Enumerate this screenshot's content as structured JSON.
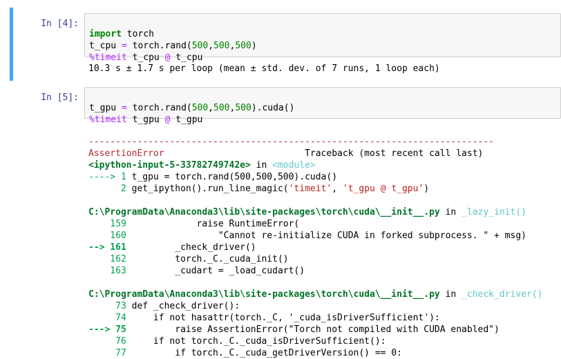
{
  "cell1": {
    "prompt": "In [4]:",
    "code": {
      "l1": {
        "kw": "import",
        "rest": " torch"
      },
      "l2": {
        "a": "t_cpu ",
        "eq": "=",
        "b": " torch.rand(",
        "n1": "500",
        "c1": ",",
        "n2": "500",
        "c2": ",",
        "n3": "500",
        "d": ")"
      },
      "l3": {
        "magic": "%timeit",
        "a": " t_cpu ",
        "at": "@",
        "b": " t_cpu"
      }
    },
    "output": "10.3 s ± 1.7 s per loop (mean ± std. dev. of 7 runs, 1 loop each)"
  },
  "cell2": {
    "prompt": "In [5]:",
    "code": {
      "l1": {
        "a": "t_gpu ",
        "eq": "=",
        "b": " torch.rand(",
        "n1": "500",
        "c1": ",",
        "n2": "500",
        "c2": ",",
        "n3": "500",
        "d": ").cuda()"
      },
      "l2": {
        "magic": "%timeit",
        "a": " t_gpu ",
        "at": "@",
        "b": " t_gpu"
      }
    },
    "traceback": {
      "dashes": "---------------------------------------------------------------------------",
      "error_name": "AssertionError",
      "header_right": "Traceback (most recent call last)",
      "frame0_file": "<ipython-input-5-33782749742e>",
      "frame0_in": " in ",
      "frame0_mod": "<module>",
      "f0_arrow": "----> 1",
      "f0_line1": " t_gpu = torch.rand(500,500,500).cuda()",
      "f0_num2": "      2",
      "f0_line2a": " get_ipython().run_line_magic(",
      "f0_s1": "'timeit'",
      "f0_line2b": ", ",
      "f0_s2": "'t_gpu @ t_gpu'",
      "f0_line2c": ")",
      "frame1_file": "C:\\ProgramData\\Anaconda3\\lib\\site-packages\\torch\\cuda\\__init__.py",
      "frame1_in": " in ",
      "frame1_func": "_lazy_init()",
      "f1_lines": [
        {
          "no": "    159",
          "code": "             raise RuntimeError("
        },
        {
          "no": "    160",
          "code": "                 \"Cannot re-initialize CUDA in forked subprocess. \" + msg)"
        },
        {
          "no": "--> 161",
          "code": "         _check_driver()"
        },
        {
          "no": "    162",
          "code": "         torch._C._cuda_init()"
        },
        {
          "no": "    163",
          "code": "         _cudart = _load_cudart()"
        }
      ],
      "frame2_file": "C:\\ProgramData\\Anaconda3\\lib\\site-packages\\torch\\cuda\\__init__.py",
      "frame2_in": " in ",
      "frame2_func": "_check_driver()",
      "f2_lines": [
        {
          "no": "     73",
          "code": " def _check_driver():"
        },
        {
          "no": "     74",
          "code": "     if not hasattr(torch._C, '_cuda_isDriverSufficient'):"
        },
        {
          "no": "---> 75",
          "code": "         raise AssertionError(\"Torch not compiled with CUDA enabled\")"
        },
        {
          "no": "     76",
          "code": "     if not torch._C._cuda_isDriverSufficient():"
        },
        {
          "no": "     77",
          "code": "         if torch._C._cuda_getDriverVersion() == 0:"
        }
      ]
    }
  }
}
